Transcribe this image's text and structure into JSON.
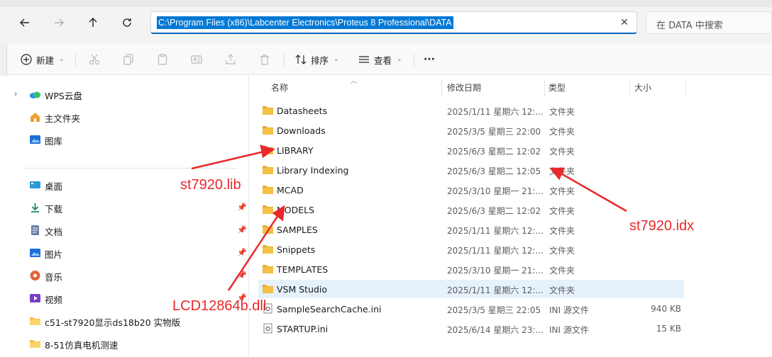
{
  "address_bar": {
    "path": "C:\\Program Files (x86)\\Labcenter Electronics\\Proteus 8 Professional\\DATA"
  },
  "search": {
    "placeholder": "在 DATA 中搜索"
  },
  "toolbar": {
    "new_label": "新建",
    "sort_label": "排序",
    "view_label": "查看",
    "more_label": "···"
  },
  "sidebar": {
    "items": [
      {
        "label": "WPS云盘",
        "icon": "cloud-icon",
        "expandable": true
      },
      {
        "label": "主文件夹",
        "icon": "home-icon"
      },
      {
        "label": "图库",
        "icon": "gallery-icon"
      },
      {
        "label": "桌面",
        "icon": "desktop-icon",
        "pinned": false
      },
      {
        "label": "下载",
        "icon": "download-icon",
        "pinned": true
      },
      {
        "label": "文档",
        "icon": "document-icon",
        "pinned": true
      },
      {
        "label": "图片",
        "icon": "pictures-icon",
        "pinned": true
      },
      {
        "label": "音乐",
        "icon": "music-icon",
        "pinned": true
      },
      {
        "label": "视频",
        "icon": "video-icon",
        "pinned": true
      },
      {
        "label": "c51-st7920显示ds18b20 实物版",
        "icon": "folder-icon"
      },
      {
        "label": "8-51仿真电机测速",
        "icon": "folder-icon"
      }
    ]
  },
  "columns": {
    "name": "名称",
    "date": "修改日期",
    "type": "类型",
    "size": "大小"
  },
  "files": [
    {
      "name": "Datasheets",
      "date": "2025/1/11 星期六 12:...",
      "type": "文件夹",
      "size": "",
      "kind": "folder"
    },
    {
      "name": "Downloads",
      "date": "2025/3/5 星期三 22:00",
      "type": "文件夹",
      "size": "",
      "kind": "folder"
    },
    {
      "name": "LIBRARY",
      "date": "2025/6/3 星期二 12:02",
      "type": "文件夹",
      "size": "",
      "kind": "folder"
    },
    {
      "name": "Library Indexing",
      "date": "2025/6/3 星期二 12:05",
      "type": "文件夹",
      "size": "",
      "kind": "folder"
    },
    {
      "name": "MCAD",
      "date": "2025/3/10 星期一 21:...",
      "type": "文件夹",
      "size": "",
      "kind": "folder"
    },
    {
      "name": "MODELS",
      "date": "2025/6/3 星期二 12:02",
      "type": "文件夹",
      "size": "",
      "kind": "folder"
    },
    {
      "name": "SAMPLES",
      "date": "2025/1/11 星期六 12:...",
      "type": "文件夹",
      "size": "",
      "kind": "folder"
    },
    {
      "name": "Snippets",
      "date": "2025/1/11 星期六 12:...",
      "type": "文件夹",
      "size": "",
      "kind": "folder"
    },
    {
      "name": "TEMPLATES",
      "date": "2025/3/10 星期一 21:...",
      "type": "文件夹",
      "size": "",
      "kind": "folder"
    },
    {
      "name": "VSM Studio",
      "date": "2025/1/11 星期六 12:...",
      "type": "文件夹",
      "size": "",
      "kind": "folder"
    },
    {
      "name": "SampleSearchCache.ini",
      "date": "2025/3/5 星期三 22:05",
      "type": "INI 源文件",
      "size": "940 KB",
      "kind": "ini"
    },
    {
      "name": "STARTUP.ini",
      "date": "2025/6/14 星期六 23:...",
      "type": "INI 源文件",
      "size": "15 KB",
      "kind": "ini"
    }
  ],
  "annotations": {
    "lib": "st7920.lib",
    "idx": "st7920.idx",
    "dll": "LCD12864b.dll",
    "color": "#e8282b"
  },
  "colors": {
    "accent": "#0078d4",
    "folder": "#f5c046",
    "row_hover": "#e5f1fb"
  }
}
